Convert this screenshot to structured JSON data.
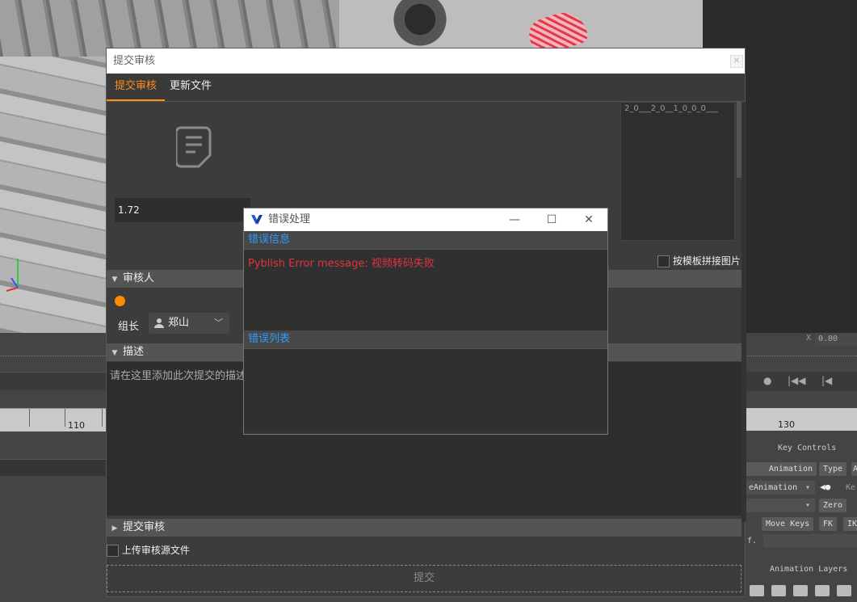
{
  "background_app": {
    "ruler_tick_left": "110",
    "ruler_tick_right": "130",
    "time_field": "0.00",
    "time_axis_label": "X",
    "key_controls_title": "Key Controls",
    "animation_btn": "Animation",
    "type_btn": "Type",
    "type_btn_extra": "A",
    "anim_dropdown": "eAnimation",
    "key_label_partial": "Ke",
    "zero_btn": "Zero",
    "move_keys_btn": "Move Keys",
    "fk_btn": "FK",
    "ik_btn": "IK",
    "f_label": "f.",
    "animation_layers_title": "Animation Layers"
  },
  "submit_window": {
    "title": "提交审核",
    "close_glyph": "✕",
    "tabs": [
      {
        "label": "提交审核",
        "active": true
      },
      {
        "label": "更新文件",
        "active": false
      }
    ],
    "version_value": "1.72",
    "preview_text": "2_0___2_0__1_0_0_0___",
    "template_checkbox_label": "按模板拼接图片",
    "reviewers_section": "审核人",
    "role_label": "组长",
    "reviewer_name": "郑山",
    "description_section": "描述",
    "description_placeholder": "请在这里添加此次提交的描述",
    "submit_section": "提交审核",
    "upload_source_label": "上传审核源文件",
    "submit_button": "提交"
  },
  "error_dialog": {
    "title": "错误处理",
    "minimize_glyph": "—",
    "maximize_glyph": "☐",
    "close_glyph": "✕",
    "info_section": "错误信息",
    "error_message": "Pyblish Error message: 视频转码失败",
    "list_section": "错误列表"
  },
  "colors": {
    "accent_orange": "#ff8c1a",
    "error_red": "#e03340",
    "link_blue": "#2b9cff"
  }
}
